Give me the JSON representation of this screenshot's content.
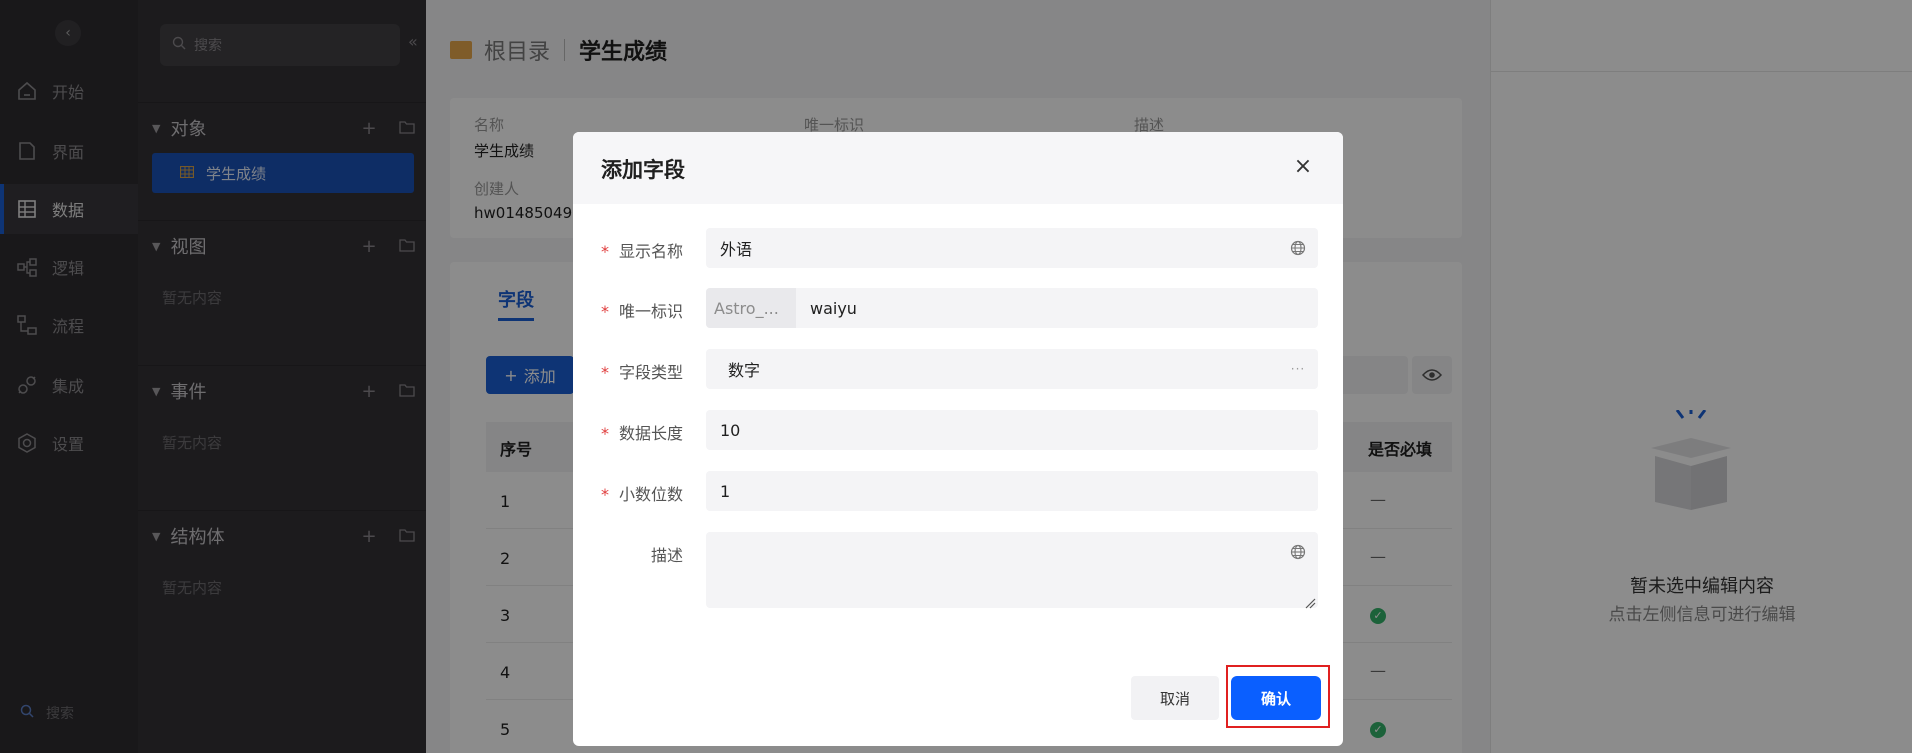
{
  "rail": {
    "items": [
      {
        "label": "开始",
        "icon": "home-icon"
      },
      {
        "label": "界面",
        "icon": "page-icon"
      },
      {
        "label": "数据",
        "icon": "table-icon"
      },
      {
        "label": "逻辑",
        "icon": "logic-icon"
      },
      {
        "label": "流程",
        "icon": "flow-icon"
      },
      {
        "label": "集成",
        "icon": "plug-icon"
      },
      {
        "label": "设置",
        "icon": "gear-icon"
      }
    ],
    "active": "数据",
    "search_label": "搜索"
  },
  "tree": {
    "search_placeholder": "搜索",
    "sections": {
      "objects": {
        "title": "对象",
        "selected_item": "学生成绩"
      },
      "views": {
        "title": "视图",
        "empty": "暂无内容"
      },
      "events": {
        "title": "事件",
        "empty": "暂无内容"
      },
      "structs": {
        "title": "结构体",
        "empty": "暂无内容"
      }
    }
  },
  "main": {
    "breadcrumb_root": "根目录",
    "breadcrumb_current": "学生成绩",
    "info": {
      "name_label": "名称",
      "name_value": "学生成绩",
      "id_label": "唯一标识",
      "desc_label": "描述",
      "creator_label": "创建人",
      "creator_value": "hw01485049"
    },
    "fields_tab": "字段",
    "add_button": "添加",
    "table": {
      "col_seq": "序号",
      "col_required": "是否必填",
      "rows": [
        {
          "seq": "1",
          "required": "—"
        },
        {
          "seq": "2",
          "required": "—"
        },
        {
          "seq": "3",
          "required": "✓"
        },
        {
          "seq": "4",
          "required": "—"
        },
        {
          "seq": "5",
          "required": "✓"
        }
      ]
    }
  },
  "right_panel": {
    "empty_title": "暂未选中编辑内容",
    "empty_hint": "点击左侧信息可进行编辑"
  },
  "dialog": {
    "title": "添加字段",
    "fields": {
      "display_name": {
        "label": "显示名称",
        "value": "外语"
      },
      "unique_id": {
        "label": "唯一标识",
        "prefix": "Astro_...",
        "value": "waiyu"
      },
      "field_type": {
        "label": "字段类型",
        "value": "数字"
      },
      "data_length": {
        "label": "数据长度",
        "value": "10"
      },
      "decimal_places": {
        "label": "小数位数",
        "value": "1"
      },
      "description": {
        "label": "描述",
        "value": ""
      }
    },
    "cancel_label": "取消",
    "confirm_label": "确认"
  },
  "colors": {
    "accent": "#0a5fff",
    "required": "#e03c3c",
    "highlight": "#e02020"
  }
}
